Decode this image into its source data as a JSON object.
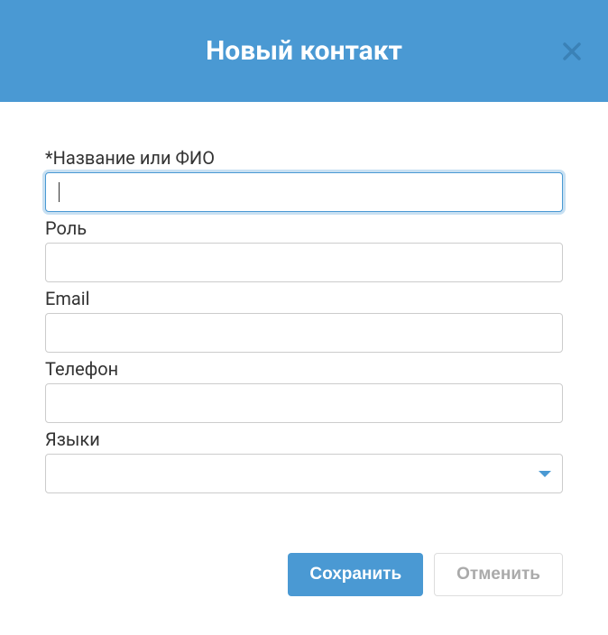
{
  "modal": {
    "title": "Новый контакт"
  },
  "form": {
    "name": {
      "label": "*Название или ФИО",
      "value": ""
    },
    "role": {
      "label": "Роль",
      "value": ""
    },
    "email": {
      "label": "Email",
      "value": ""
    },
    "phone": {
      "label": "Телефон",
      "value": ""
    },
    "languages": {
      "label": "Языки",
      "value": ""
    }
  },
  "buttons": {
    "save": "Сохранить",
    "cancel": "Отменить"
  }
}
